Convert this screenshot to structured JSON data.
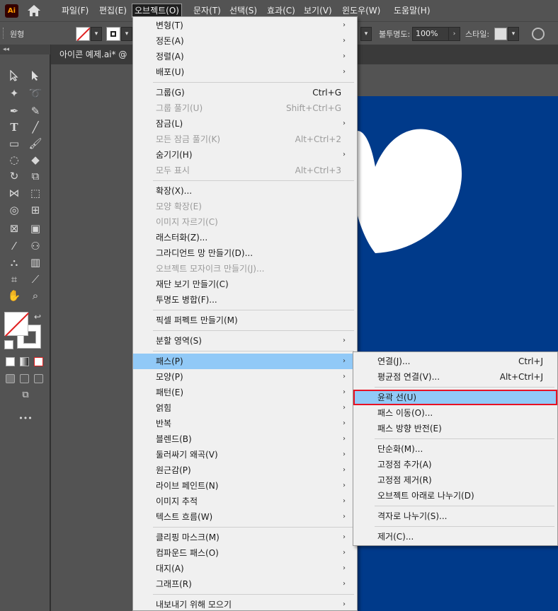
{
  "menubar": {
    "logo": "Ai",
    "items": [
      "파일(F)",
      "편집(E)",
      "오브젝트(O)",
      "문자(T)",
      "선택(S)",
      "효과(C)",
      "보기(V)",
      "윈도우(W)",
      "도움말(H)"
    ]
  },
  "control": {
    "shape_label": "원형",
    "opacity_label": "불투명도:",
    "opacity_value": "100%",
    "style_label": "스타일:"
  },
  "toolbar": {
    "collapse": "◂◂",
    "more": "•••"
  },
  "document": {
    "tab": "아이콘 예제.ai* @"
  },
  "object_menu": [
    {
      "label": "변형(T)",
      "sub": true
    },
    {
      "label": "정돈(A)",
      "sub": true
    },
    {
      "label": "정렬(A)",
      "sub": true
    },
    {
      "label": "배포(U)",
      "sub": true
    },
    {
      "sep": true
    },
    {
      "label": "그룹(G)",
      "shortcut": "Ctrl+G"
    },
    {
      "label": "그룹 풀기(U)",
      "shortcut": "Shift+Ctrl+G",
      "disabled": true
    },
    {
      "label": "잠금(L)",
      "sub": true
    },
    {
      "label": "모든 잠금 풀기(K)",
      "shortcut": "Alt+Ctrl+2",
      "disabled": true
    },
    {
      "label": "숨기기(H)",
      "sub": true
    },
    {
      "label": "모두 표시",
      "shortcut": "Alt+Ctrl+3",
      "disabled": true
    },
    {
      "sep": true
    },
    {
      "label": "확장(X)..."
    },
    {
      "label": "모양 확장(E)",
      "disabled": true
    },
    {
      "label": "이미지 자르기(C)",
      "disabled": true
    },
    {
      "label": "래스터화(Z)..."
    },
    {
      "label": "그라디언트 망 만들기(D)..."
    },
    {
      "label": "오브젝트 모자이크 만들기(J)...",
      "disabled": true
    },
    {
      "label": "재단 보기 만들기(C)"
    },
    {
      "label": "투명도 병합(F)..."
    },
    {
      "sep": true
    },
    {
      "label": "픽셀 퍼펙트 만들기(M)"
    },
    {
      "sep": true
    },
    {
      "label": "분할 영역(S)",
      "sub": true
    },
    {
      "sep": true
    },
    {
      "label": "패스(P)",
      "sub": true,
      "selected": true
    },
    {
      "label": "모양(P)",
      "sub": true
    },
    {
      "label": "패턴(E)",
      "sub": true
    },
    {
      "label": "얽힘",
      "sub": true
    },
    {
      "label": "반복",
      "sub": true
    },
    {
      "label": "블렌드(B)",
      "sub": true
    },
    {
      "label": "둘러싸기 왜곡(V)",
      "sub": true
    },
    {
      "label": "원근감(P)",
      "sub": true
    },
    {
      "label": "라이브 페인트(N)",
      "sub": true
    },
    {
      "label": "이미지 추적",
      "sub": true
    },
    {
      "label": "텍스트 흐름(W)",
      "sub": true
    },
    {
      "sep": true
    },
    {
      "label": "클리핑 마스크(M)",
      "sub": true
    },
    {
      "label": "컴파운드 패스(O)",
      "sub": true
    },
    {
      "label": "대지(A)",
      "sub": true
    },
    {
      "label": "그래프(R)",
      "sub": true
    },
    {
      "sep": true
    },
    {
      "label": "내보내기 위해 모으기",
      "sub": true
    }
  ],
  "path_menu": [
    {
      "label": "연결(J)...",
      "shortcut": "Ctrl+J"
    },
    {
      "label": "평균점 연결(V)...",
      "shortcut": "Alt+Ctrl+J"
    },
    {
      "sep": true
    },
    {
      "label": "윤곽 선(U)",
      "highlighted": true
    },
    {
      "label": "패스 이동(O)..."
    },
    {
      "label": "패스 방향 반전(E)"
    },
    {
      "sep": true
    },
    {
      "label": "단순화(M)..."
    },
    {
      "label": "고정점 추가(A)"
    },
    {
      "label": "고정점 제거(R)"
    },
    {
      "label": "오브젝트 아래로 나누기(D)"
    },
    {
      "sep": true
    },
    {
      "label": "격자로 나누기(S)..."
    },
    {
      "sep": true
    },
    {
      "label": "제거(C)..."
    }
  ],
  "colors": {
    "artboard": "#003a8a",
    "highlight": "#91c9f7",
    "highlight_border": "#e81123"
  }
}
